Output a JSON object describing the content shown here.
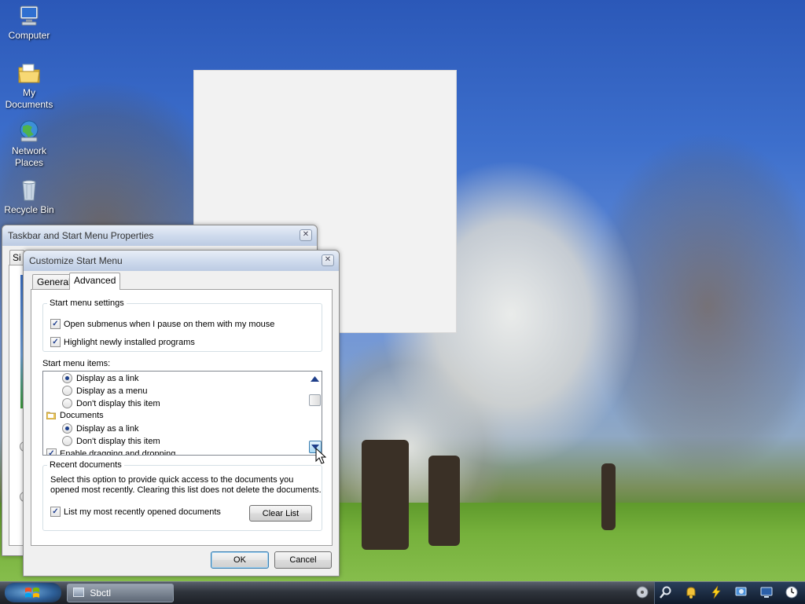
{
  "desktop": {
    "icons": [
      {
        "label": "Computer",
        "icon": "computer-icon"
      },
      {
        "label": "My Documents",
        "icon": "folder-documents-icon"
      },
      {
        "label": "Network Places",
        "icon": "network-globe-icon"
      },
      {
        "label": "Recycle Bin",
        "icon": "recycle-bin-icon"
      }
    ]
  },
  "taskbar_props": {
    "title": "Taskbar and Start Menu Properties",
    "tab_partial": "Sta"
  },
  "customize": {
    "title": "Customize Start Menu",
    "tabs": [
      "General",
      "Advanced"
    ],
    "active_tab": "Advanced",
    "start_menu_settings": {
      "legend": "Start menu settings",
      "options": [
        {
          "label": "Open submenus when I pause on them with my mouse",
          "checked": true
        },
        {
          "label": "Highlight newly installed programs",
          "checked": true
        }
      ]
    },
    "start_menu_items": {
      "label": "Start menu items:",
      "rows": [
        {
          "type": "radio",
          "label": "Display as a link",
          "checked": true
        },
        {
          "type": "radio",
          "label": "Display as a menu",
          "checked": false
        },
        {
          "type": "radio",
          "label": "Don't display this item",
          "checked": false
        },
        {
          "type": "header",
          "label": "Documents"
        },
        {
          "type": "radio",
          "label": "Display as a link",
          "checked": true
        },
        {
          "type": "radio",
          "label": "Don't display this item",
          "checked": false
        },
        {
          "type": "checkbox",
          "label": "Enable dragging and dropping",
          "checked": true
        }
      ]
    },
    "recent_documents": {
      "legend": "Recent documents",
      "description": "Select this option to provide quick access to the documents you opened most recently.  Clearing this list does not delete the documents.",
      "description_line1": "Select this option to provide quick access to the documents you",
      "description_line2": "opened most recently.  Clearing this list does not delete the documents.",
      "checkbox_label": "List my most recently opened documents",
      "checked": true,
      "clear_button": "Clear List"
    },
    "ok_button": "OK",
    "cancel_button": "Cancel"
  },
  "taskbar": {
    "task_label": "Sbctl"
  }
}
